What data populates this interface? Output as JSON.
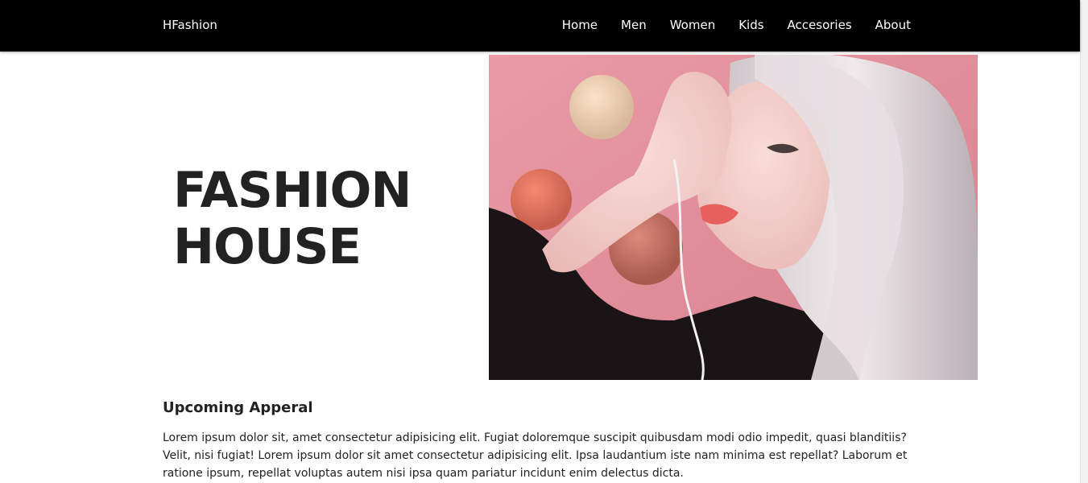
{
  "navbar": {
    "brand": "HFashion",
    "links": [
      "Home",
      "Men",
      "Women",
      "Kids",
      "Accesories",
      "About"
    ],
    "background": "#000000"
  },
  "hero": {
    "title_line1": "FASHION",
    "title_line2": "HOUSE",
    "image_subject": "fashion-model-photo"
  },
  "section": {
    "heading": "Upcoming Apperal",
    "body": "Lorem ipsum dolor sit, amet consectetur adipisicing elit. Fugiat doloremque suscipit quibusdam modi odio impedit, quasi blanditiis? Velit, nisi fugiat! Lorem ipsum dolor sit amet consectetur adipisicing elit. Ipsa laudantium iste nam minima est repellat? Laborum et ratione ipsum, repellat voluptas autem nisi ipsa quam pariatur incidunt enim delectus dicta."
  }
}
